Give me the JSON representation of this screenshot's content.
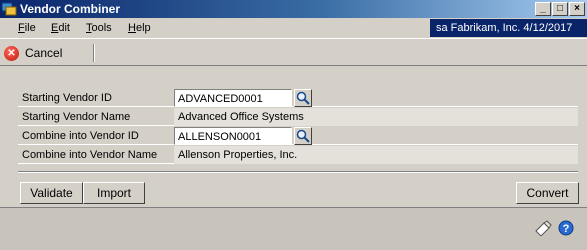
{
  "window": {
    "title": "Vendor Combiner",
    "minimize_glyph": "_",
    "maximize_glyph": "□",
    "close_glyph": "×"
  },
  "menu": {
    "items": [
      {
        "label": "File",
        "accel": "F"
      },
      {
        "label": "Edit",
        "accel": "E"
      },
      {
        "label": "Tools",
        "accel": "T"
      },
      {
        "label": "Help",
        "accel": "H"
      }
    ],
    "user_info": "sa  Fabrikam, Inc.  4/12/2017"
  },
  "toolbar": {
    "cancel_label": "Cancel",
    "cancel_icon": "cancel-x-icon"
  },
  "form": {
    "starting_vendor_id_label": "Starting Vendor ID",
    "starting_vendor_id_value": "ADVANCED0001",
    "starting_vendor_name_label": "Starting Vendor Name",
    "starting_vendor_name_value": "Advanced Office Systems",
    "combine_vendor_id_label": "Combine into Vendor ID",
    "combine_vendor_id_value": "ALLENSON0001",
    "combine_vendor_name_label": "Combine into Vendor Name",
    "combine_vendor_name_value": "Allenson Properties, Inc."
  },
  "buttons": {
    "validate": "Validate",
    "import": "Import",
    "convert": "Convert"
  },
  "colors": {
    "title_gradient_start": "#0a246a",
    "userbar_bg": "#0a246a",
    "window_bg": "#d4d0c8"
  }
}
